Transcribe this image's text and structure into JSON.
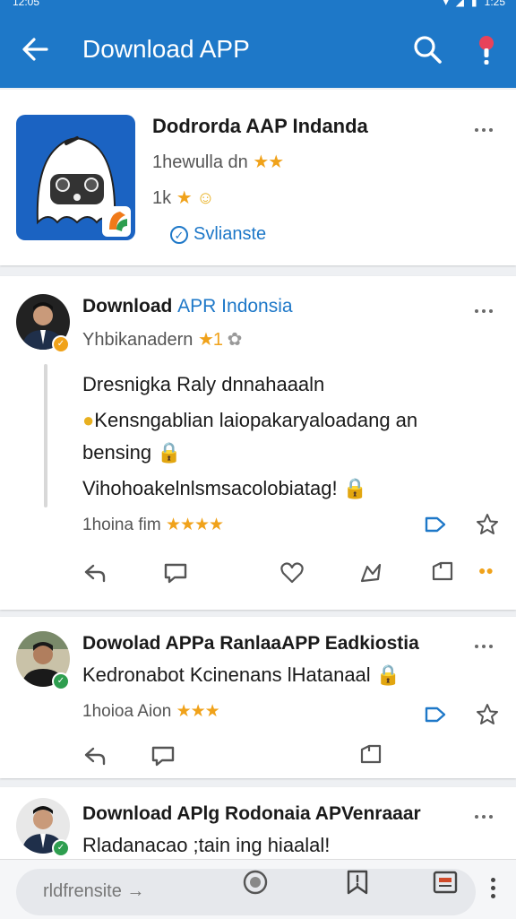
{
  "status": {
    "time": "12:05",
    "clock_right": "1:25"
  },
  "appbar": {
    "title": "Download APP"
  },
  "app_card": {
    "title": "Dodrorda AAP Indanda",
    "subtitle": "1hewulla dn",
    "subtitle_stars": "★★",
    "count": "1k",
    "count_star": "★",
    "verified_label": "Svlianste"
  },
  "posts": [
    {
      "title_main": "Download ",
      "title_highlight": "APR Indonsia",
      "handle": "Yhbikanadern",
      "handle_star": "★1",
      "lines": [
        "Dresnigka Raly dnnahaaaln",
        "Kensngablian laiopakaryaloadang an",
        "bensing",
        "Vihohoakelnlsmsacolobiatag!"
      ],
      "meta": "1hoina fim",
      "meta_stars": "★★★★"
    },
    {
      "title_main": "Dowolad APPa RanlaaAPP Eadkiostia",
      "line": "Kedronabot Kcinenans lHatanaal",
      "meta": "1hoioa Aion",
      "meta_stars": "★★★"
    },
    {
      "title_main": "Download APlg Rodonaia APVenraaar",
      "line": "Rladanacao ;tain ing hiaalal!"
    }
  ],
  "bottombar": {
    "url_text": "rldfrensite"
  },
  "colors": {
    "primary": "#1e78c8",
    "star": "#f0a21a",
    "verified": "#2e9e4f"
  }
}
